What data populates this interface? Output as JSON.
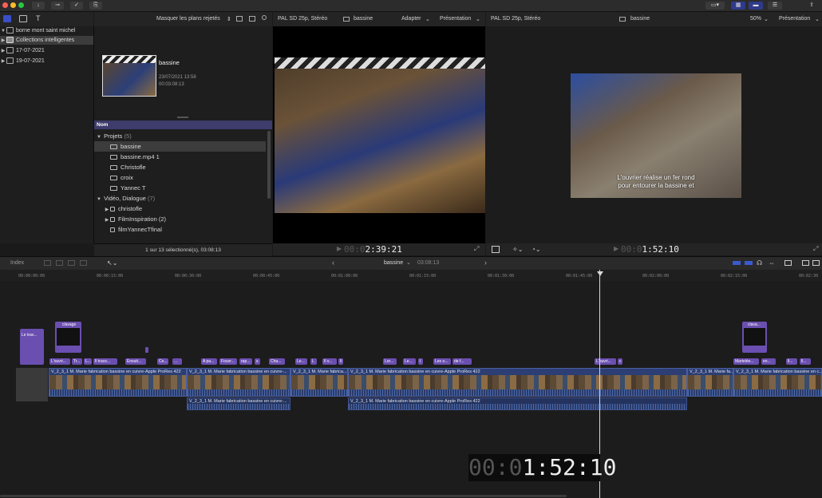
{
  "colors": {
    "accent": "#3d3c6b",
    "clip": "#2a3a6a",
    "title": "#6b4fb0",
    "playhead": "#d8d8d8"
  },
  "library": {
    "items": [
      {
        "label": "borne mont saint michel",
        "icon": "library-icon",
        "disclosure": "▼"
      },
      {
        "label": "Collections intelligentes",
        "icon": "folder-icon",
        "disclosure": "▶"
      },
      {
        "label": "17-07-2021",
        "icon": "event-icon",
        "disclosure": "▶"
      },
      {
        "label": "19-07-2021",
        "icon": "event-icon",
        "disclosure": "▶"
      }
    ]
  },
  "browser": {
    "filter_label": "Masquer les plans rejetés",
    "filter_chevron": "⇕",
    "clip": {
      "name": "bassine",
      "date": "23/07/2021 13:58",
      "duration": "00:03:08:13"
    },
    "column_header": "Nom",
    "groups": [
      {
        "label": "Projets",
        "count": "(5)",
        "items": [
          "bassine",
          "bassine.mp4 1",
          "Christofle",
          "croix",
          "Yannec T"
        ]
      },
      {
        "label": "Vidéo, Dialogue",
        "count": "(7)",
        "items": [
          "christofle",
          "FilmInspiration (2)",
          "filmYannecTfinal"
        ]
      }
    ],
    "footer": "1 sur 13 sélectionné(s), 03:08:13"
  },
  "viewer": {
    "format": "PAL SD 25p, Stéréo",
    "clip_name": "bassine",
    "fit_label": "Adapter",
    "view_label": "Présentation",
    "timecode_dim": "00:0",
    "timecode": "2:39:21"
  },
  "event_viewer": {
    "format": "PAL SD 25p, Stéréo",
    "clip_name": "bassine",
    "zoom": "50%",
    "view_label": "Présentation",
    "subtitle_line1": "L'ouvrier réalise un fer rond",
    "subtitle_line2": "pour entourer la bassine et",
    "timecode_dim": "00:0",
    "timecode": "1:52:10"
  },
  "timeline": {
    "index_label": "Index",
    "project_name": "bassine",
    "project_duration": "03:08:13",
    "ruler": [
      "00:00:00:00",
      "00:00:15:00",
      "00:00:30:00",
      "00:00:45:00",
      "00:01:00:00",
      "00:01:15:00",
      "00:01:30:00",
      "00:01:45:00",
      "00:02:00:00",
      "00:02:15:00",
      "00:02:30"
    ],
    "titles": [
      {
        "label": "Le trav..."
      },
      {
        "label": "clavage"
      },
      {
        "label": "clava..."
      }
    ],
    "captions": [
      "L'ouvri...",
      "Tr...",
      "L...",
      "Il trace...",
      "Ensuit...",
      "Ce...",
      "...",
      "A pa...",
      "Fouvr...",
      "rap...",
      "s",
      "Cha...",
      "Le...",
      "L",
      "Il v...",
      "Il",
      "Lor...",
      "Le...",
      "I",
      "Les o...",
      "de f...",
      "L'ouvri...",
      "c",
      "Martelée...",
      "en...",
      "ll...",
      "ll..."
    ],
    "clip_name": "V_2_3_1 M. Marie fabrication bassine en cuivre-Apple ProRes 422",
    "clip_name_short1": "V_2_3_1 M. Marie fabrication bassine en cuivre-...",
    "clip_name_short2": "V_2_3_1 M. Marie fabrica...",
    "clip_name_short3": "V_2_3_1 M. Marie fa...",
    "clip_name_short4": "V_2_3_1 M. Marie fabrication bassine en c...",
    "audio_label": "V_2_3_1 M. Marie fabrication bassine en cuivre-...",
    "big_timecode_dim": "00:0",
    "big_timecode": "1:52:10"
  }
}
